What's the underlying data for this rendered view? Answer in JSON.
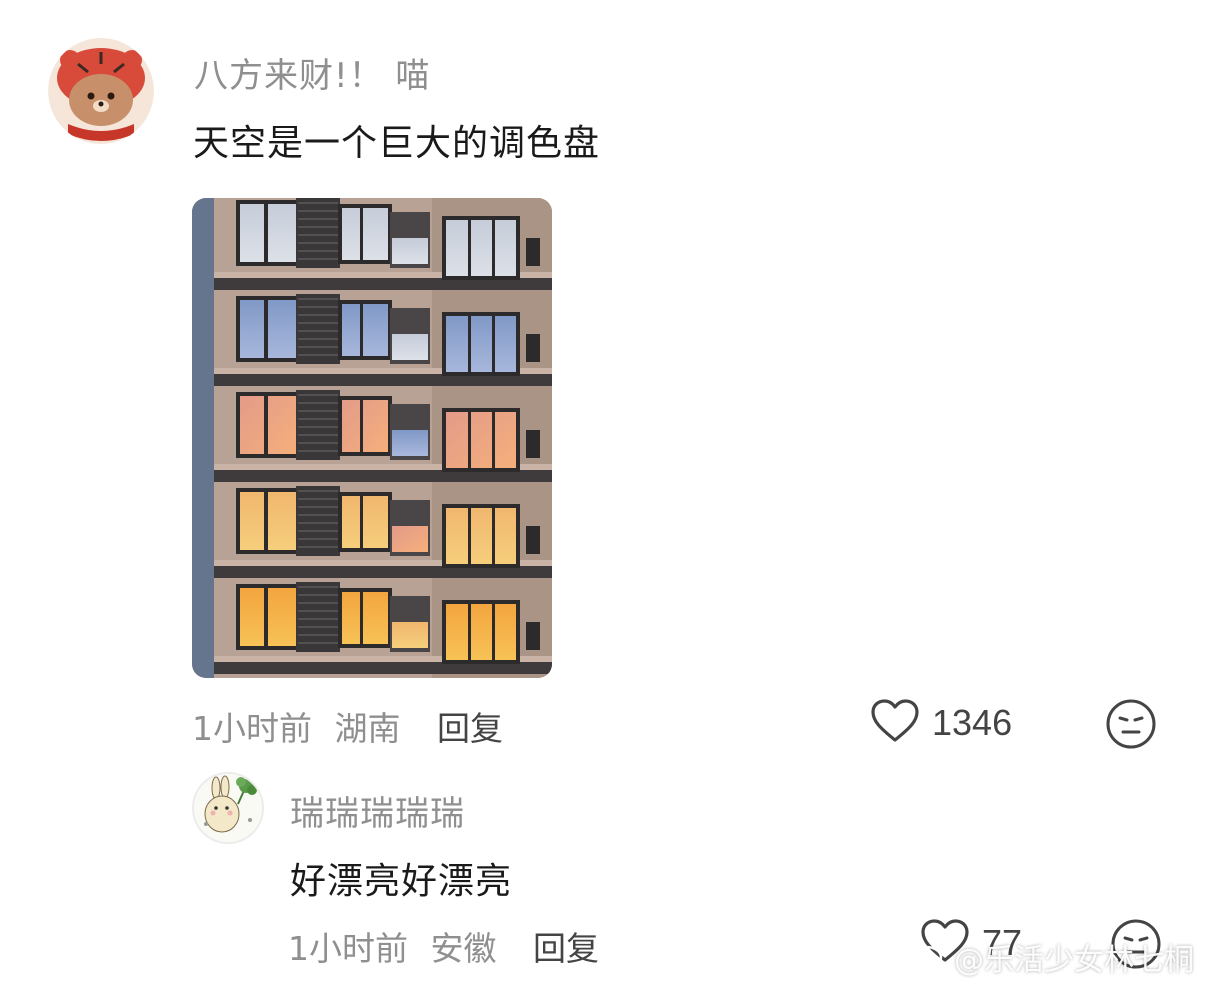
{
  "comments": [
    {
      "username": "八方来财!！ 喵",
      "text": "天空是一个巨大的调色盘",
      "time": "1小时前",
      "location": "湖南",
      "reply_label": "回复",
      "likes": "1346"
    },
    {
      "username": "瑞瑞瑞瑞瑞",
      "text": "好漂亮好漂亮",
      "time": "1小时前",
      "location": "安徽",
      "reply_label": "回复",
      "likes": "77"
    }
  ],
  "watermark": {
    "text": "@乐活少女林七桐"
  },
  "icons": {
    "like": "heart-outline-icon",
    "reaction": "neutral-face-icon",
    "watermark_logo": "weibo-logo-icon"
  },
  "colors": {
    "username": "#8f8f8f",
    "text": "#1a1a1a",
    "meta": "#8f8f8f",
    "icon": "#444444"
  }
}
